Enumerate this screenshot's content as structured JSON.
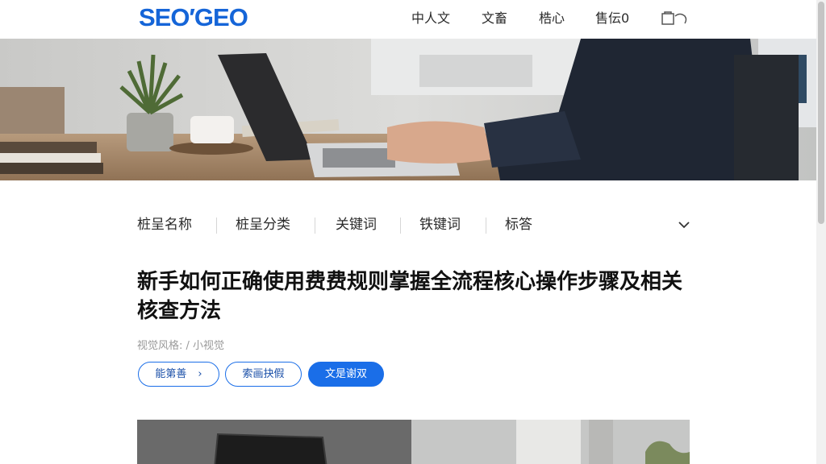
{
  "header": {
    "logo": "SEO′GEO",
    "nav": [
      "中人文",
      "文畜",
      "梏心",
      "售伝0"
    ]
  },
  "filters": {
    "items": [
      "桩呈名称",
      "桩呈分类",
      "关键词",
      "铁键词",
      "标答"
    ]
  },
  "article": {
    "title": "新手如何正确使用费费规则掌握全流程核心操作步骤及相关核查方法",
    "meta": "视觉风格: / 小视觉",
    "buttons": [
      "能第善",
      "索画抉假",
      "文是谢双"
    ]
  },
  "icons": {
    "cart": "cart-icon",
    "chevron": "chevron-down-icon",
    "arrow": "chevron-right-icon"
  },
  "colors": {
    "brand": "#1565d8",
    "primary_button": "#1a6ee8"
  }
}
